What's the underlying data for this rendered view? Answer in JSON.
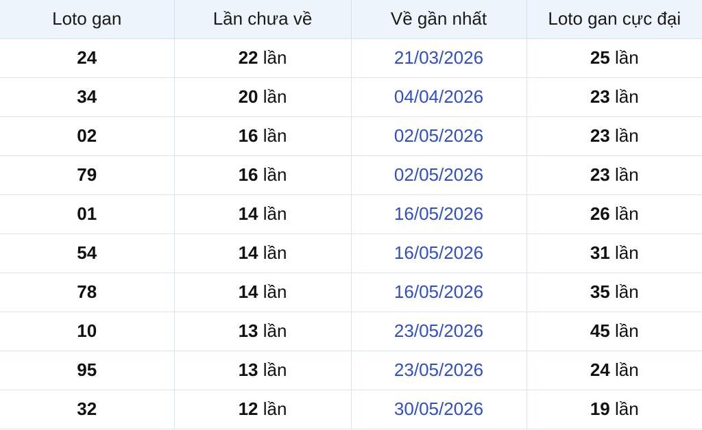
{
  "table": {
    "headers": [
      "Loto gan",
      "Lần chưa về",
      "Về gần nhất",
      "Loto gan cực đại"
    ],
    "unit": "lần",
    "rows": [
      {
        "loto": "24",
        "missing": "22",
        "last_date": "21/03/2026",
        "max": "25"
      },
      {
        "loto": "34",
        "missing": "20",
        "last_date": "04/04/2026",
        "max": "23"
      },
      {
        "loto": "02",
        "missing": "16",
        "last_date": "02/05/2026",
        "max": "23"
      },
      {
        "loto": "79",
        "missing": "16",
        "last_date": "02/05/2026",
        "max": "23"
      },
      {
        "loto": "01",
        "missing": "14",
        "last_date": "16/05/2026",
        "max": "26"
      },
      {
        "loto": "54",
        "missing": "14",
        "last_date": "16/05/2026",
        "max": "31"
      },
      {
        "loto": "78",
        "missing": "14",
        "last_date": "16/05/2026",
        "max": "35"
      },
      {
        "loto": "10",
        "missing": "13",
        "last_date": "23/05/2026",
        "max": "45"
      },
      {
        "loto": "95",
        "missing": "13",
        "last_date": "23/05/2026",
        "max": "24"
      },
      {
        "loto": "32",
        "missing": "12",
        "last_date": "30/05/2026",
        "max": "19"
      }
    ]
  },
  "colors": {
    "header_bg": "#eef4fc",
    "date_text": "#2f4fc4",
    "border": "#dde3ea"
  }
}
